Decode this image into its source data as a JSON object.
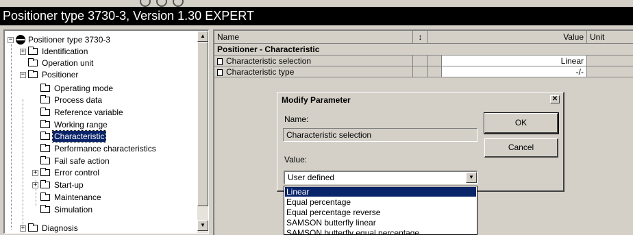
{
  "window": {
    "title": "Positioner type 3730-3, Version 1.30 EXPERT"
  },
  "tree": {
    "items": [
      {
        "label": "Positioner type 3730-3"
      },
      {
        "label": "Identification"
      },
      {
        "label": "Operation unit"
      },
      {
        "label": "Positioner"
      },
      {
        "label": "Operating mode"
      },
      {
        "label": "Process data"
      },
      {
        "label": "Reference variable"
      },
      {
        "label": "Working range"
      },
      {
        "label": "Characteristic"
      },
      {
        "label": "Performance characteristics"
      },
      {
        "label": "Fail safe action"
      },
      {
        "label": "Error control"
      },
      {
        "label": "Start-up"
      },
      {
        "label": "Maintenance"
      },
      {
        "label": "Simulation"
      },
      {
        "label": "Diagnosis"
      }
    ]
  },
  "grid": {
    "headers": {
      "name": "Name",
      "sort": "↕",
      "value": "Value",
      "unit": "Unit"
    },
    "group": "Positioner - Characteristic",
    "rows": [
      {
        "name": "Characteristic selection",
        "value": "Linear"
      },
      {
        "name": "Characteristic type",
        "value": "-/-"
      }
    ]
  },
  "dialog": {
    "title": "Modify Parameter",
    "close": "✕",
    "name_label": "Name:",
    "name_value": "Characteristic selection",
    "value_label": "Value:",
    "ok": "OK",
    "cancel": "Cancel",
    "combo_value": "User defined",
    "options": [
      "Linear",
      "Equal percentage",
      "Equal percentage reverse",
      "SAMSON butterfly linear",
      "SAMSON butterfly equal percentage"
    ]
  }
}
